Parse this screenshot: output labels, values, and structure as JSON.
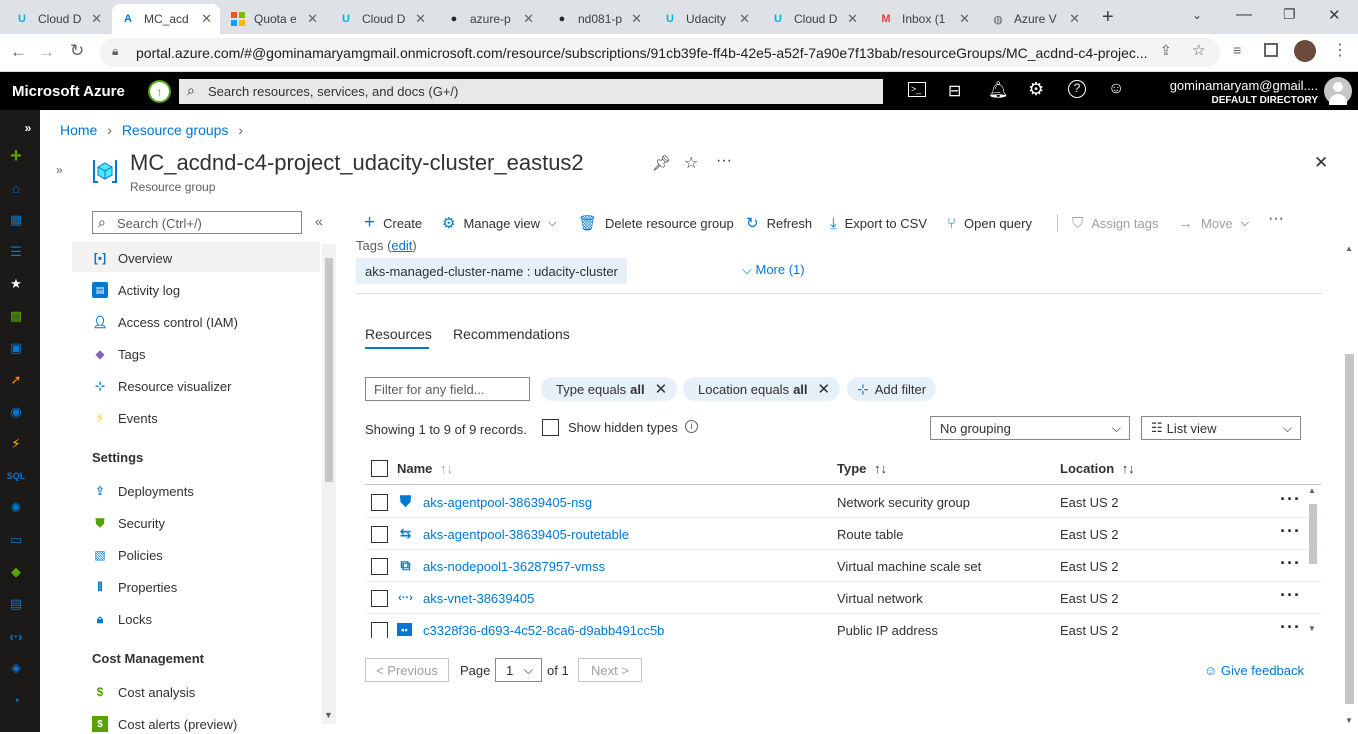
{
  "browser": {
    "tabs": [
      {
        "title": "Cloud D",
        "icon": "udacity-icon",
        "color": "#02b3e4"
      },
      {
        "title": "MC_acd",
        "icon": "azure-icon",
        "color": "#0078d4"
      },
      {
        "title": "Quota e",
        "icon": "microsoft-icon",
        "color": "#f25022"
      },
      {
        "title": "Cloud D",
        "icon": "udacity-icon",
        "color": "#02b3e4"
      },
      {
        "title": "azure-p",
        "icon": "github-icon",
        "color": "#24292e"
      },
      {
        "title": "nd081-p",
        "icon": "github-icon",
        "color": "#24292e"
      },
      {
        "title": "Udacity",
        "icon": "udacity-icon",
        "color": "#02b3e4"
      },
      {
        "title": "Cloud D",
        "icon": "udacity-icon",
        "color": "#02b3e4"
      },
      {
        "title": "Inbox (1",
        "icon": "gmail-icon",
        "color": "#ea4335"
      },
      {
        "title": "Azure V",
        "icon": "globe-icon",
        "color": "#5f6368"
      }
    ],
    "url": "portal.azure.com/#@gominamaryamgmail.onmicrosoft.com/resource/subscriptions/91cb39fe-ff4b-42e5-a52f-7a90e7f13bab/resourceGroups/MC_acdnd-c4-projec..."
  },
  "azure_header": {
    "brand": "Microsoft Azure",
    "search_placeholder": "Search resources, services, and docs (G+/)",
    "user_email": "gominamaryam@gmail....",
    "directory": "DEFAULT DIRECTORY"
  },
  "breadcrumb": {
    "home": "Home",
    "resource_groups": "Resource groups"
  },
  "blade": {
    "title": "MC_acdnd-c4-project_udacity-cluster_eastus2",
    "subtitle": "Resource group"
  },
  "menu": {
    "search_placeholder": "Search (Ctrl+/)",
    "items": [
      {
        "label": "Overview",
        "icon": "resource-group-icon",
        "color": "#0078d4"
      },
      {
        "label": "Activity log",
        "icon": "activity-log-icon",
        "color": "#0078d4"
      },
      {
        "label": "Access control (IAM)",
        "icon": "people-icon",
        "color": "#0078d4"
      },
      {
        "label": "Tags",
        "icon": "tag-icon",
        "color": "#8661c5"
      },
      {
        "label": "Resource visualizer",
        "icon": "visualizer-icon",
        "color": "#0078d4"
      },
      {
        "label": "Events",
        "icon": "lightning-icon",
        "color": "#f2c811"
      }
    ],
    "settings_header": "Settings",
    "settings_items": [
      {
        "label": "Deployments",
        "icon": "upload-icon",
        "color": "#0078d4"
      },
      {
        "label": "Security",
        "icon": "shield-icon",
        "color": "#57a300"
      },
      {
        "label": "Policies",
        "icon": "policy-icon",
        "color": "#0078d4"
      },
      {
        "label": "Properties",
        "icon": "properties-icon",
        "color": "#0078d4"
      },
      {
        "label": "Locks",
        "icon": "lock-icon",
        "color": "#0078d4"
      }
    ],
    "cost_header": "Cost Management",
    "cost_items": [
      {
        "label": "Cost analysis",
        "icon": "cost-analysis-icon",
        "color": "#57a300"
      },
      {
        "label": "Cost alerts (preview)",
        "icon": "cost-alert-icon",
        "color": "#57a300"
      }
    ]
  },
  "toolbar": {
    "create": "Create",
    "manage_view": "Manage view",
    "delete": "Delete resource group",
    "refresh": "Refresh",
    "export": "Export to CSV",
    "open_query": "Open query",
    "assign_tags": "Assign tags",
    "move": "Move"
  },
  "essentials": {
    "tags_label": "Tags",
    "tags_edit": "edit",
    "tag_value": "aks-managed-cluster-name : udacity-cluster",
    "more": "More (1)"
  },
  "tabs": {
    "resources": "Resources",
    "recommendations": "Recommendations"
  },
  "filters": {
    "placeholder": "Filter for any field...",
    "type_pill": "Type equals",
    "type_value": "all",
    "location_pill": "Location equals",
    "location_value": "all",
    "add_filter": "Add filter"
  },
  "records": {
    "showing": "Showing 1 to 9 of 9 records.",
    "show_hidden": "Show hidden types",
    "grouping": "No grouping",
    "view": "List view"
  },
  "table": {
    "headers": {
      "name": "Name",
      "type": "Type",
      "location": "Location"
    },
    "rows": [
      {
        "name": "aks-agentpool-38639405-nsg",
        "type": "Network security group",
        "location": "East US 2",
        "icon": "nsg-shield-icon",
        "color": "#0078d4"
      },
      {
        "name": "aks-agentpool-38639405-routetable",
        "type": "Route table",
        "location": "East US 2",
        "icon": "route-table-icon",
        "color": "#0078d4"
      },
      {
        "name": "aks-nodepool1-36287957-vmss",
        "type": "Virtual machine scale set",
        "location": "East US 2",
        "icon": "vmss-icon",
        "color": "#0078d4"
      },
      {
        "name": "aks-vnet-38639405",
        "type": "Virtual network",
        "location": "East US 2",
        "icon": "vnet-icon",
        "color": "#0078d4"
      },
      {
        "name": "c3328f36-d693-4c52-8ca6-d9abb491cc5b",
        "type": "Public IP address",
        "location": "East US 2",
        "icon": "public-ip-icon",
        "color": "#0078d4"
      }
    ]
  },
  "pagination": {
    "previous": "< Previous",
    "page_label": "Page",
    "page_value": "1",
    "of": "of 1",
    "next": "Next >"
  },
  "feedback": "Give feedback"
}
